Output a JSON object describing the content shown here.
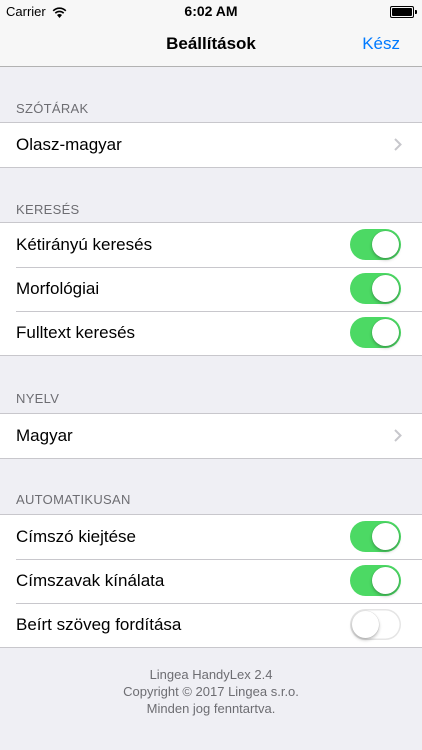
{
  "status_bar": {
    "carrier": "Carrier",
    "time": "6:02 AM"
  },
  "navbar": {
    "title": "Beállítások",
    "done_label": "Kész",
    "accent_color": "#007aff"
  },
  "sections": [
    {
      "header": "SZÓTÁRAK",
      "rows": [
        {
          "label": "Olasz-magyar",
          "accessory": "chevron"
        }
      ]
    },
    {
      "header": "KERESÉS",
      "rows": [
        {
          "label": "Kétirányú keresés",
          "toggle": true
        },
        {
          "label": "Morfológiai",
          "toggle": true
        },
        {
          "label": "Fulltext keresés",
          "toggle": true
        }
      ]
    },
    {
      "header": "NYELV",
      "rows": [
        {
          "label": "Magyar",
          "accessory": "chevron"
        }
      ]
    },
    {
      "header": "AUTOMATIKUSAN",
      "rows": [
        {
          "label": "Címszó kiejtése",
          "toggle": true
        },
        {
          "label": "Címszavak kínálata",
          "toggle": true
        },
        {
          "label": "Beírt szöveg fordítása",
          "toggle": false
        }
      ]
    }
  ],
  "footer": {
    "line1": "Lingea HandyLex 2.4",
    "line2": "Copyright © 2017 Lingea s.r.o.",
    "line3": "Minden jog fenntartva."
  },
  "colors": {
    "toggle_on": "#4cd964",
    "background": "#efeff4"
  }
}
